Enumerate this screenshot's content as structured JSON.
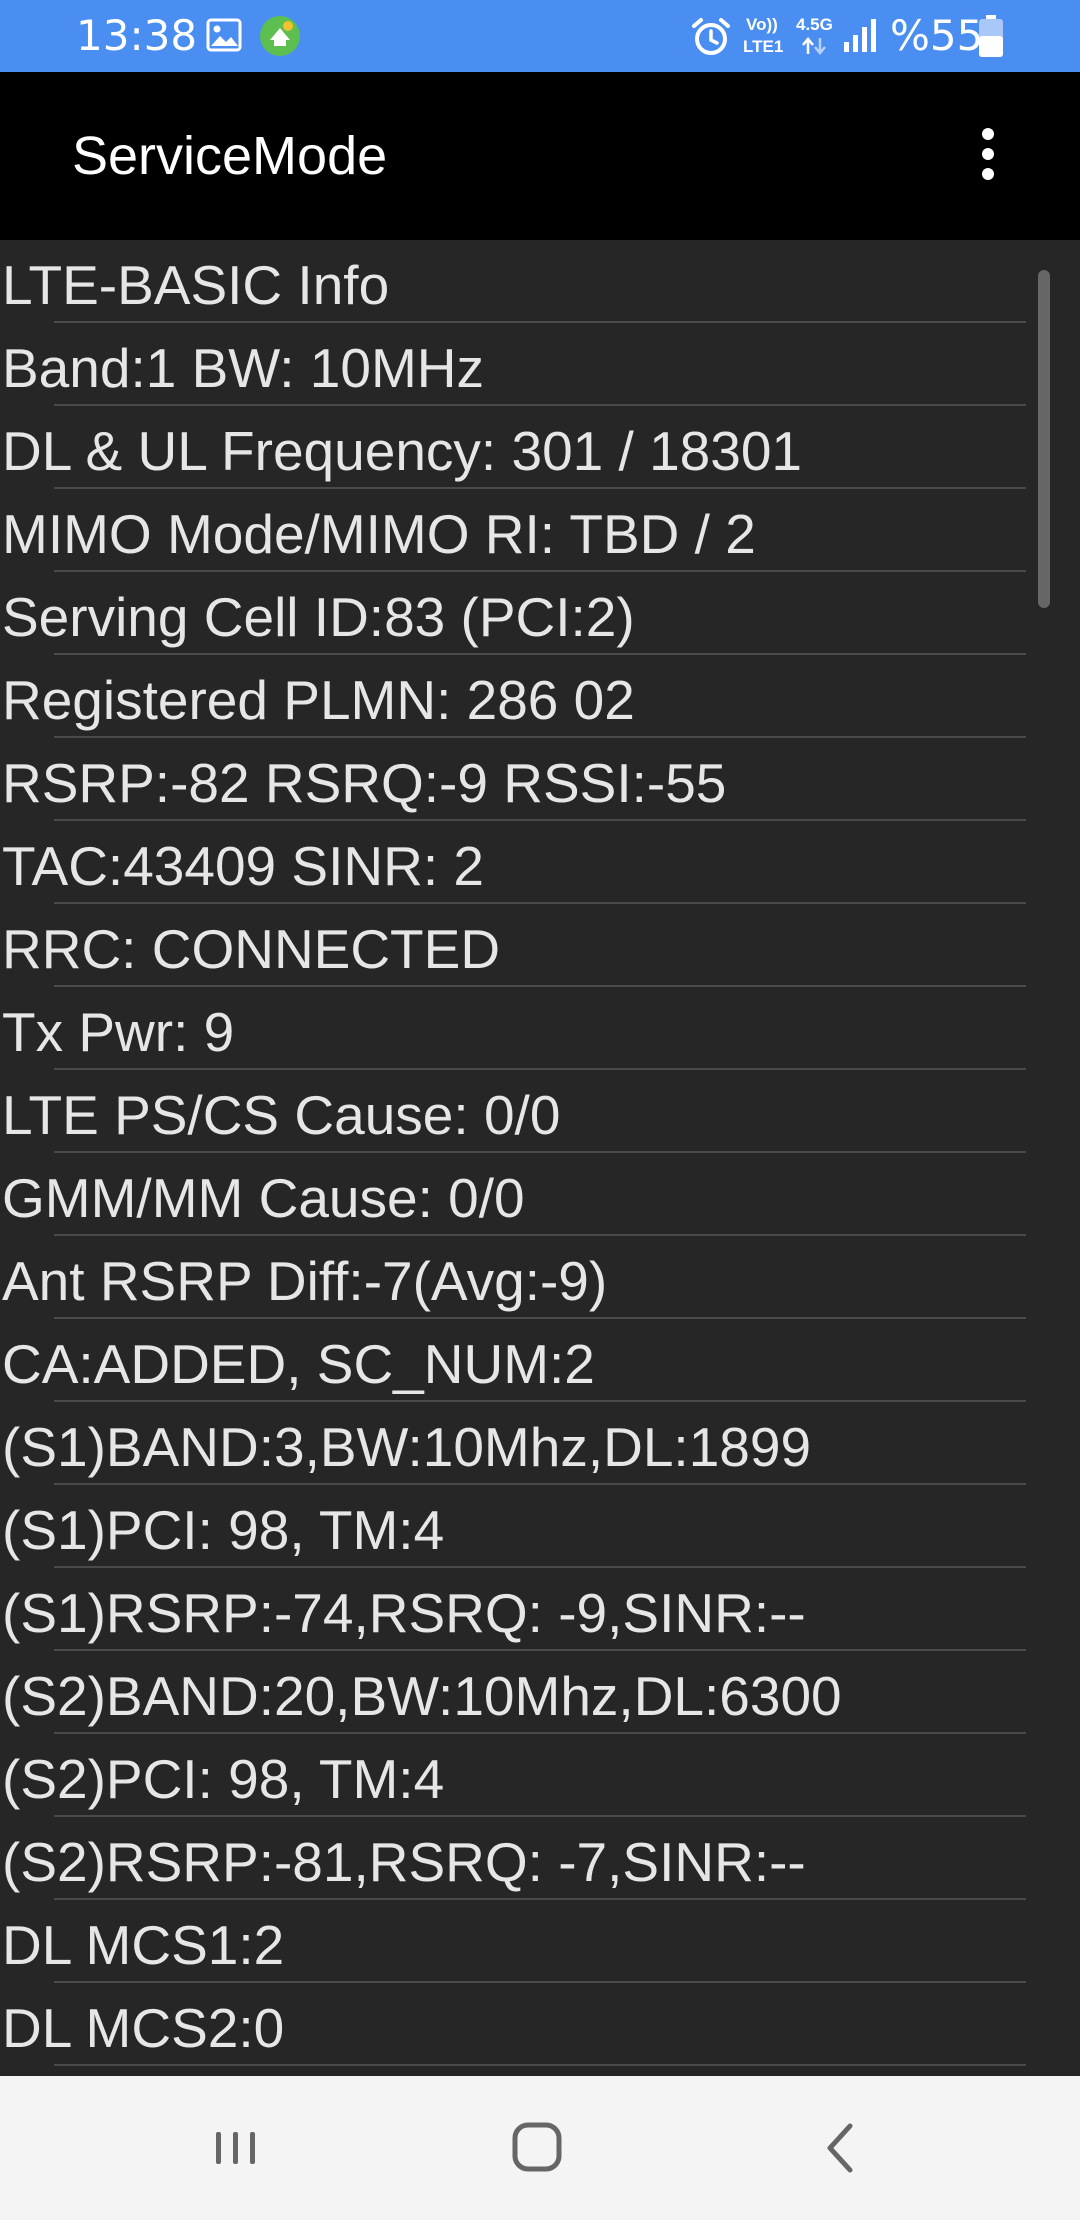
{
  "status_bar": {
    "time": "13:38",
    "network_volte": "Vo))",
    "network_lte": "LTE1",
    "network_gen": "4.5G",
    "battery_text": "%55",
    "icons": [
      "gallery-icon",
      "app-notification-icon",
      "alarm-icon",
      "volte-icon",
      "data-arrows-icon",
      "signal-icon",
      "battery-icon"
    ]
  },
  "app_bar": {
    "title": "ServiceMode",
    "menu_icon": "more-vert-icon"
  },
  "info_rows": [
    "LTE-BASIC Info",
    "Band:1 BW: 10MHz",
    "DL & UL Frequency: 301 / 18301",
    "MIMO Mode/MIMO RI: TBD / 2",
    "Serving Cell ID:83 (PCI:2)",
    "Registered PLMN: 286 02",
    "RSRP:-82 RSRQ:-9 RSSI:-55",
    "TAC:43409 SINR: 2",
    "RRC: CONNECTED",
    "Tx Pwr: 9",
    "LTE PS/CS Cause: 0/0",
    "GMM/MM Cause: 0/0",
    "Ant RSRP Diff:-7(Avg:-9)",
    "CA:ADDED, SC_NUM:2",
    "(S1)BAND:3,BW:10Mhz,DL:1899",
    "(S1)PCI: 98, TM:4",
    "(S1)RSRP:-74,RSRQ: -9,SINR:--",
    "(S2)BAND:20,BW:10Mhz,DL:6300",
    "(S2)PCI: 98, TM:4",
    "(S2)RSRP:-81,RSRQ: -7,SINR:--",
    "DL MCS1:2",
    "DL MCS2:0",
    ""
  ],
  "nav_bar": {
    "icons": [
      "recent-apps-icon",
      "home-icon",
      "back-icon"
    ]
  },
  "colors": {
    "status_bar_bg": "#4a8ef2",
    "app_bar_bg": "#000000",
    "content_bg": "#262626",
    "text": "#e6e6e6",
    "divider": "#4a4a4a",
    "nav_bar_bg": "#f4f4f4",
    "nav_icon": "#666666"
  }
}
